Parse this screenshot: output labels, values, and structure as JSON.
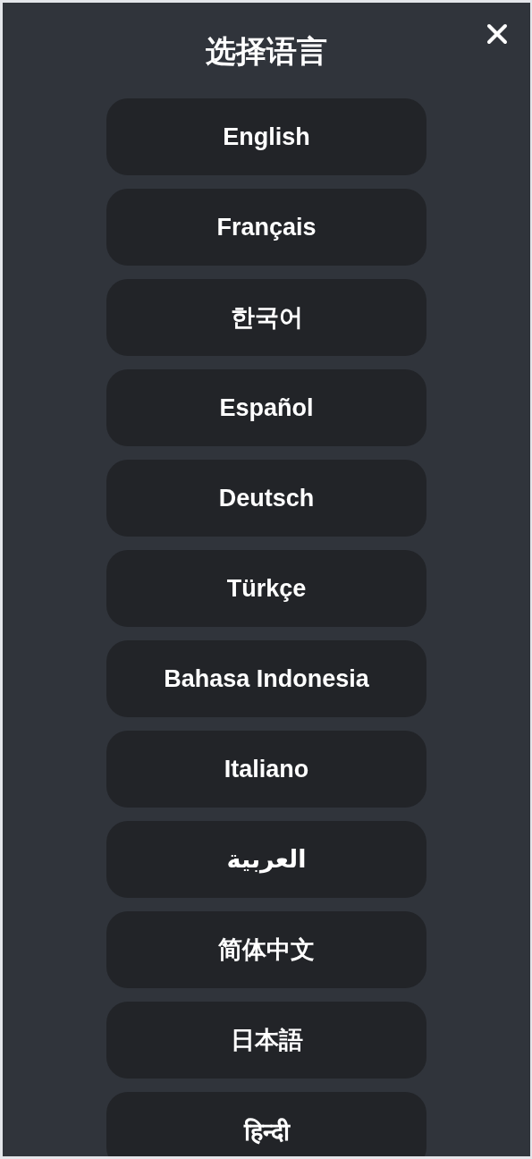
{
  "title": "选择语言",
  "languages": [
    "English",
    "Français",
    "한국어",
    "Español",
    "Deutsch",
    "Türkçe",
    "Bahasa Indonesia",
    "Italiano",
    "العربية",
    "简体中文",
    "日本語",
    "हिन्दी"
  ]
}
